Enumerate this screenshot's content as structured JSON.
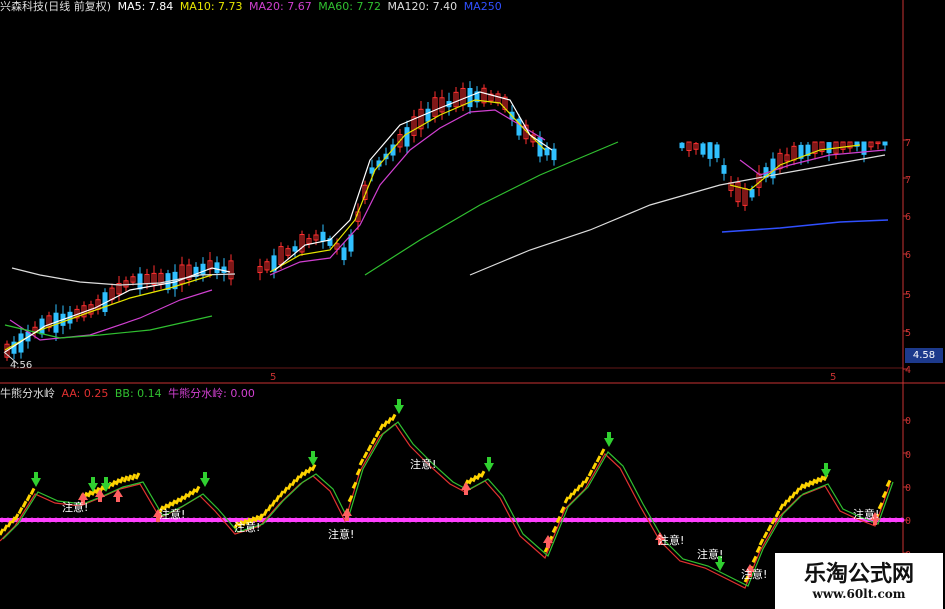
{
  "header": {
    "stock_name": "兴森科技(日线 前复权)",
    "ma_items": [
      {
        "label": "MA5: 7.84",
        "color": "#ffffff"
      },
      {
        "label": "MA10: 7.73",
        "color": "#e6e600"
      },
      {
        "label": "MA20: 7.67",
        "color": "#d040d0"
      },
      {
        "label": "MA60: 7.72",
        "color": "#30c030"
      },
      {
        "label": "MA120: 7.40",
        "color": "#dddddd"
      },
      {
        "label": "MA250",
        "color": "#3050ff"
      }
    ]
  },
  "indicator": {
    "name": "牛熊分水岭",
    "items": [
      {
        "label": "AA: 0.25",
        "color": "#e03030"
      },
      {
        "label": "BB: 0.14",
        "color": "#30c030"
      },
      {
        "label": "牛熊分水岭: 0.00",
        "color": "#d040d0"
      }
    ],
    "annotation_text": "注意!",
    "annotation_count": 9
  },
  "price_axis": {
    "ticks": [
      "7",
      "7",
      "6",
      "6",
      "5",
      "5",
      "4"
    ],
    "current_price": "4.58",
    "low_label": "4.56"
  },
  "indicator_axis": {
    "ticks": [
      "0",
      "0",
      "0",
      "0",
      "0"
    ]
  },
  "period_markers": [
    "5",
    "5"
  ],
  "watermark": {
    "title": "乐淘公式网",
    "url": "www.60lt.com"
  },
  "colors": {
    "up": "#ff3030",
    "down": "#30c0ff",
    "axis": "#c83232",
    "bull_line": "#ff40ff",
    "aa": "#e03030",
    "bb": "#30c030"
  }
}
